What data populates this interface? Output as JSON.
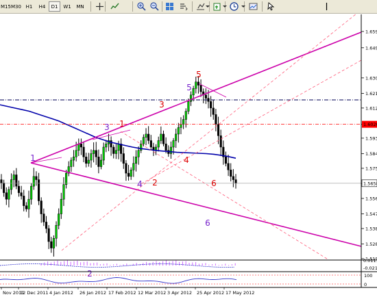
{
  "toolbar": {
    "timeframes": [
      {
        "label": "M15",
        "active": false
      },
      {
        "label": "M30",
        "active": false
      },
      {
        "label": "H1",
        "active": false
      },
      {
        "label": "H4",
        "active": false
      },
      {
        "label": "D1",
        "active": true
      },
      {
        "label": "W1",
        "active": false
      },
      {
        "label": "MN",
        "active": false
      }
    ],
    "icons": [
      "crosshair-cursor-icon",
      "line-chart-icon",
      "zoom-in-icon",
      "zoom-out-icon",
      "tile-windows-icon",
      "chart-shift-icon",
      "auto-scroll-icon",
      "new-order-icon",
      "clock-icon",
      "template-icon",
      "arrow-cursor-icon",
      "vertical-line-icon"
    ]
  },
  "colors": {
    "background": "#ffffff",
    "candle": "#000000",
    "bull_candle": "#00cc00",
    "ma_line": "#0000aa",
    "channel": "#cc00aa",
    "fib_dashed": "#ff4466",
    "wave_red": "#dd0000",
    "wave_purple": "#7722cc",
    "hline_dark": "#000055",
    "hline_red": "#ff0000",
    "current_price_tag": "#ff0000",
    "histogram": "#cc66ff",
    "osc_line": "#3333cc"
  },
  "wave_labels": [
    {
      "text": "1",
      "color": "purple"
    },
    {
      "text": "2",
      "color": "purple"
    },
    {
      "text": "3",
      "color": "purple"
    },
    {
      "text": "4",
      "color": "purple"
    },
    {
      "text": "5",
      "color": "purple"
    },
    {
      "text": "6",
      "color": "purple"
    },
    {
      "text": "1",
      "color": "red"
    },
    {
      "text": "2",
      "color": "red"
    },
    {
      "text": "3",
      "color": "red"
    },
    {
      "text": "4",
      "color": "red"
    },
    {
      "text": "5",
      "color": "red"
    },
    {
      "text": "6",
      "color": "red"
    }
  ],
  "price_axis": {
    "labels": [
      "1.6590",
      "1.6490",
      "1.6305",
      "1.6210",
      "1.6120",
      "1.6020",
      "1.5935",
      "1.5840",
      "1.5750",
      "1.5655",
      "1.5565",
      "1.5470",
      "1.5380",
      "1.5285",
      "1.5195"
    ],
    "current_price_tag": "1.6020",
    "bid_tag": "1.5658",
    "oscillator_labels": [
      "0.0111",
      "-0.0216",
      "100",
      "0"
    ]
  },
  "time_axis": {
    "labels": [
      "Nov 2011",
      "12 Dec 2011",
      "4 Jan 2012",
      "26 Jan 2012",
      "17 Feb 2012",
      "12 Mar 2012",
      "3 Apr 2012",
      "25 Apr 2012",
      "17 May 2012"
    ]
  },
  "chart_data": {
    "type": "candlestick",
    "symbol_note": "",
    "x": [
      "Nov 2011",
      "12 Dec 2011",
      "4 Jan 2012",
      "26 Jan 2012",
      "17 Feb 2012",
      "12 Mar 2012",
      "3 Apr 2012",
      "25 Apr 2012",
      "17 May 2012"
    ],
    "price_range": [
      1.5195,
      1.659
    ],
    "close_series": [
      1.566,
      1.56,
      1.556,
      1.562,
      1.568,
      1.571,
      1.564,
      1.56,
      1.558,
      1.552,
      1.55,
      1.556,
      1.564,
      1.57,
      1.568,
      1.555,
      1.547,
      1.542,
      1.538,
      1.53,
      1.526,
      1.532,
      1.54,
      1.547,
      1.556,
      1.565,
      1.572,
      1.576,
      1.58,
      1.582,
      1.586,
      1.59,
      1.588,
      1.582,
      1.578,
      1.58,
      1.584,
      1.586,
      1.582,
      1.576,
      1.58,
      1.588,
      1.59,
      1.592,
      1.588,
      1.584,
      1.586,
      1.59,
      1.584,
      1.578,
      1.572,
      1.57,
      1.574,
      1.578,
      1.582,
      1.586,
      1.59,
      1.594,
      1.596,
      1.592,
      1.588,
      1.586,
      1.588,
      1.592,
      1.596,
      1.59,
      1.586,
      1.584,
      1.588,
      1.592,
      1.596,
      1.6,
      1.602,
      1.605,
      1.61,
      1.616,
      1.62,
      1.624,
      1.628,
      1.626,
      1.622,
      1.62,
      1.618,
      1.616,
      1.612,
      1.608,
      1.602,
      1.595,
      1.588,
      1.582,
      1.578,
      1.574,
      1.57,
      1.568,
      1.5658
    ],
    "moving_average": {
      "name": "",
      "values": [
        1.614,
        1.613,
        1.612,
        1.611,
        1.61,
        1.6085,
        1.607,
        1.6055,
        1.604,
        1.602,
        1.6,
        1.598,
        1.596,
        1.594,
        1.5925,
        1.591,
        1.59,
        1.589,
        1.588,
        1.5872,
        1.5866,
        1.586,
        1.5856,
        1.5852,
        1.5848,
        1.5846,
        1.5844,
        1.5842,
        1.584,
        1.5836,
        1.583,
        1.5822,
        1.5812
      ]
    },
    "horizontal_lines": [
      1.617,
      1.602,
      1.5658
    ],
    "indicator_panels": [
      {
        "type": "histogram",
        "range": [
          -0.0216,
          0.0111
        ]
      },
      {
        "type": "line",
        "range": [
          0,
          100
        ]
      }
    ],
    "xlabel": "",
    "ylabel": "",
    "grid": false,
    "legend": "none"
  }
}
